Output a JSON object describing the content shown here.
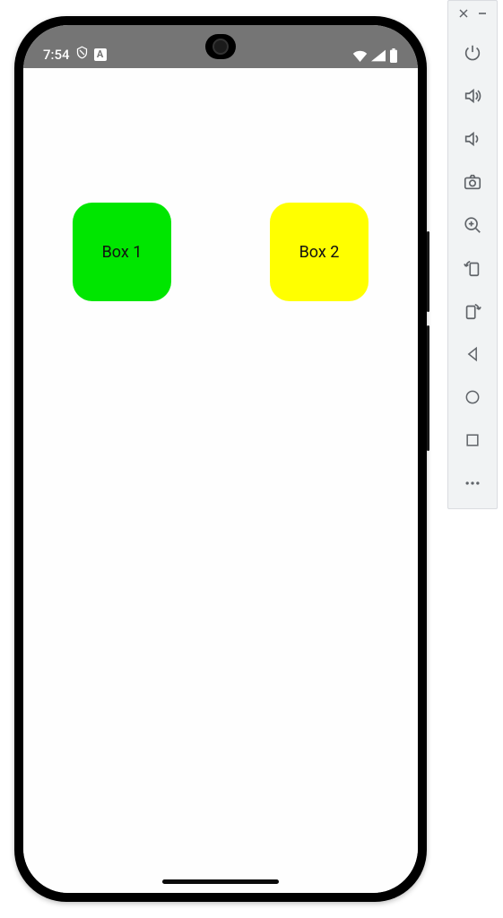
{
  "status_bar": {
    "time": "7:54",
    "icons_left": [
      "privacy-shield",
      "square-a"
    ],
    "icons_right": [
      "wifi",
      "cell-signal",
      "battery-full"
    ]
  },
  "app": {
    "boxes": [
      {
        "label": "Box 1",
        "bg": "#00E600"
      },
      {
        "label": "Box 2",
        "bg": "#FFFF00"
      }
    ]
  },
  "toolbar": {
    "close": "×",
    "minimize": "−",
    "items": [
      "power",
      "volume-up",
      "volume-down",
      "camera",
      "zoom-in",
      "rotate-ccw",
      "rotate-cw",
      "back",
      "home",
      "overview",
      "more"
    ]
  }
}
